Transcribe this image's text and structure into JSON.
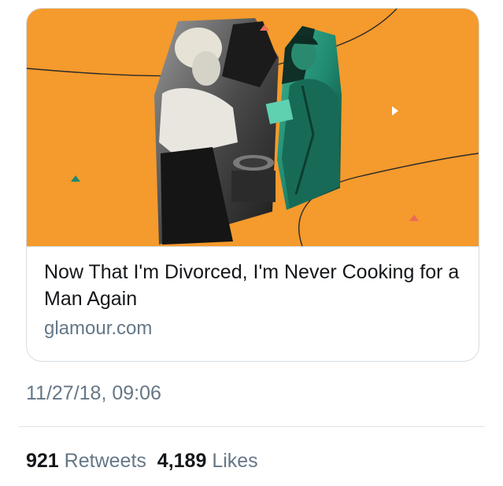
{
  "card": {
    "title": "Now That I'm Divorced, I'm Never Cooking for a Man Again",
    "domain": "glamour.com",
    "image_background": "#f59a2c",
    "image_accent": "#1f8a70"
  },
  "tweet": {
    "timestamp": "11/27/18, 09:06"
  },
  "stats": {
    "retweets_count": "921",
    "retweets_label": "Retweets",
    "likes_count": "4,189",
    "likes_label": "Likes"
  }
}
